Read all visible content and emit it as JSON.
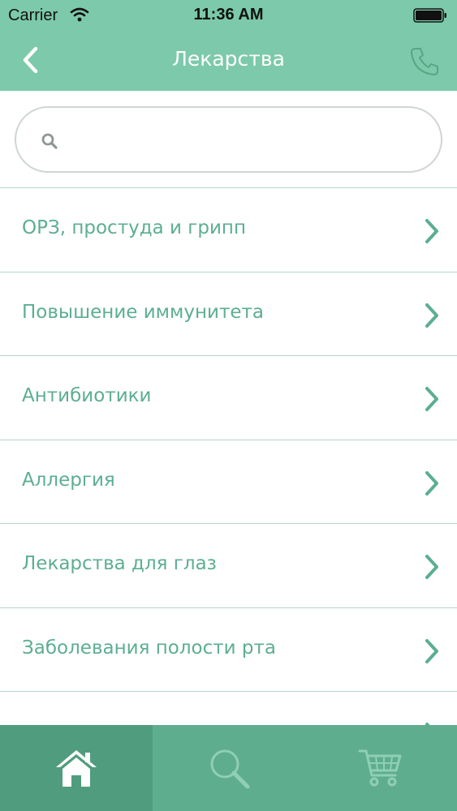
{
  "status_bar": {
    "carrier": "Carrier",
    "time": "11:36 AM",
    "icons": [
      "wifi-icon",
      "battery-icon"
    ]
  },
  "nav": {
    "title": "Лекарства",
    "back_icon": "chevron-left-icon",
    "call_icon": "phone-icon"
  },
  "search": {
    "value": "",
    "placeholder": "",
    "icon": "search-icon"
  },
  "categories": [
    {
      "label": "ОРЗ, простуда и грипп"
    },
    {
      "label": "Повышение иммунитета"
    },
    {
      "label": "Антибиотики"
    },
    {
      "label": "Аллергия"
    },
    {
      "label": "Лекарства для глаз"
    },
    {
      "label": "Заболевания полости рта"
    }
  ],
  "tabs": [
    {
      "icon": "home-icon",
      "active": true
    },
    {
      "icon": "search-icon",
      "active": false
    },
    {
      "icon": "cart-icon",
      "active": false
    }
  ],
  "colors": {
    "header": "#7cc9ab",
    "accent_text": "#5cae93",
    "divider": "#b3d6c8",
    "tab_bar": "#5fad8f",
    "tab_active": "#4f9c7e"
  }
}
